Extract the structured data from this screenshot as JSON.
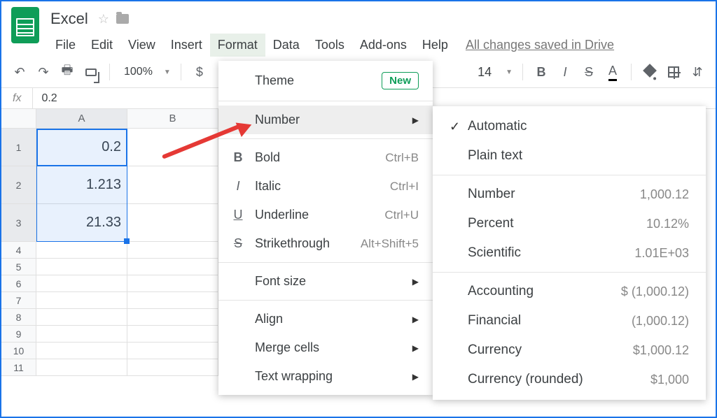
{
  "doc": {
    "name": "Excel",
    "save_status": "All changes saved in Drive"
  },
  "menu": {
    "file": "File",
    "edit": "Edit",
    "view": "View",
    "insert": "Insert",
    "format": "Format",
    "data": "Data",
    "tools": "Tools",
    "addons": "Add-ons",
    "help": "Help"
  },
  "toolbar": {
    "zoom": "100%",
    "fontsize": "14",
    "currency": "$",
    "bold": "B",
    "italic": "I",
    "strike": "S",
    "textcolor": "A"
  },
  "formula": {
    "fx": "fx",
    "value": "0.2"
  },
  "columns": {
    "A": "A",
    "B": "B"
  },
  "rows": {
    "r1": "1",
    "r2": "2",
    "r3": "3",
    "r4": "4",
    "r5": "5",
    "r6": "6",
    "r7": "7",
    "r8": "8",
    "r9": "9",
    "r10": "10",
    "r11": "11"
  },
  "cells": {
    "a1": "0.2",
    "a2": "1.213",
    "a3": "21.33"
  },
  "format_menu": {
    "theme": "Theme",
    "new": "New",
    "number": "Number",
    "bold": "Bold",
    "bold_sc": "Ctrl+B",
    "italic": "Italic",
    "italic_sc": "Ctrl+I",
    "underline": "Underline",
    "underline_sc": "Ctrl+U",
    "strike": "Strikethrough",
    "strike_sc": "Alt+Shift+5",
    "fontsize": "Font size",
    "align": "Align",
    "merge": "Merge cells",
    "wrap": "Text wrapping"
  },
  "number_menu": {
    "automatic": "Automatic",
    "plain": "Plain text",
    "number": "Number",
    "number_ex": "1,000.12",
    "percent": "Percent",
    "percent_ex": "10.12%",
    "scientific": "Scientific",
    "scientific_ex": "1.01E+03",
    "accounting": "Accounting",
    "accounting_ex": "$ (1,000.12)",
    "financial": "Financial",
    "financial_ex": "(1,000.12)",
    "currency": "Currency",
    "currency_ex": "$1,000.12",
    "currency_r": "Currency (rounded)",
    "currency_r_ex": "$1,000"
  }
}
